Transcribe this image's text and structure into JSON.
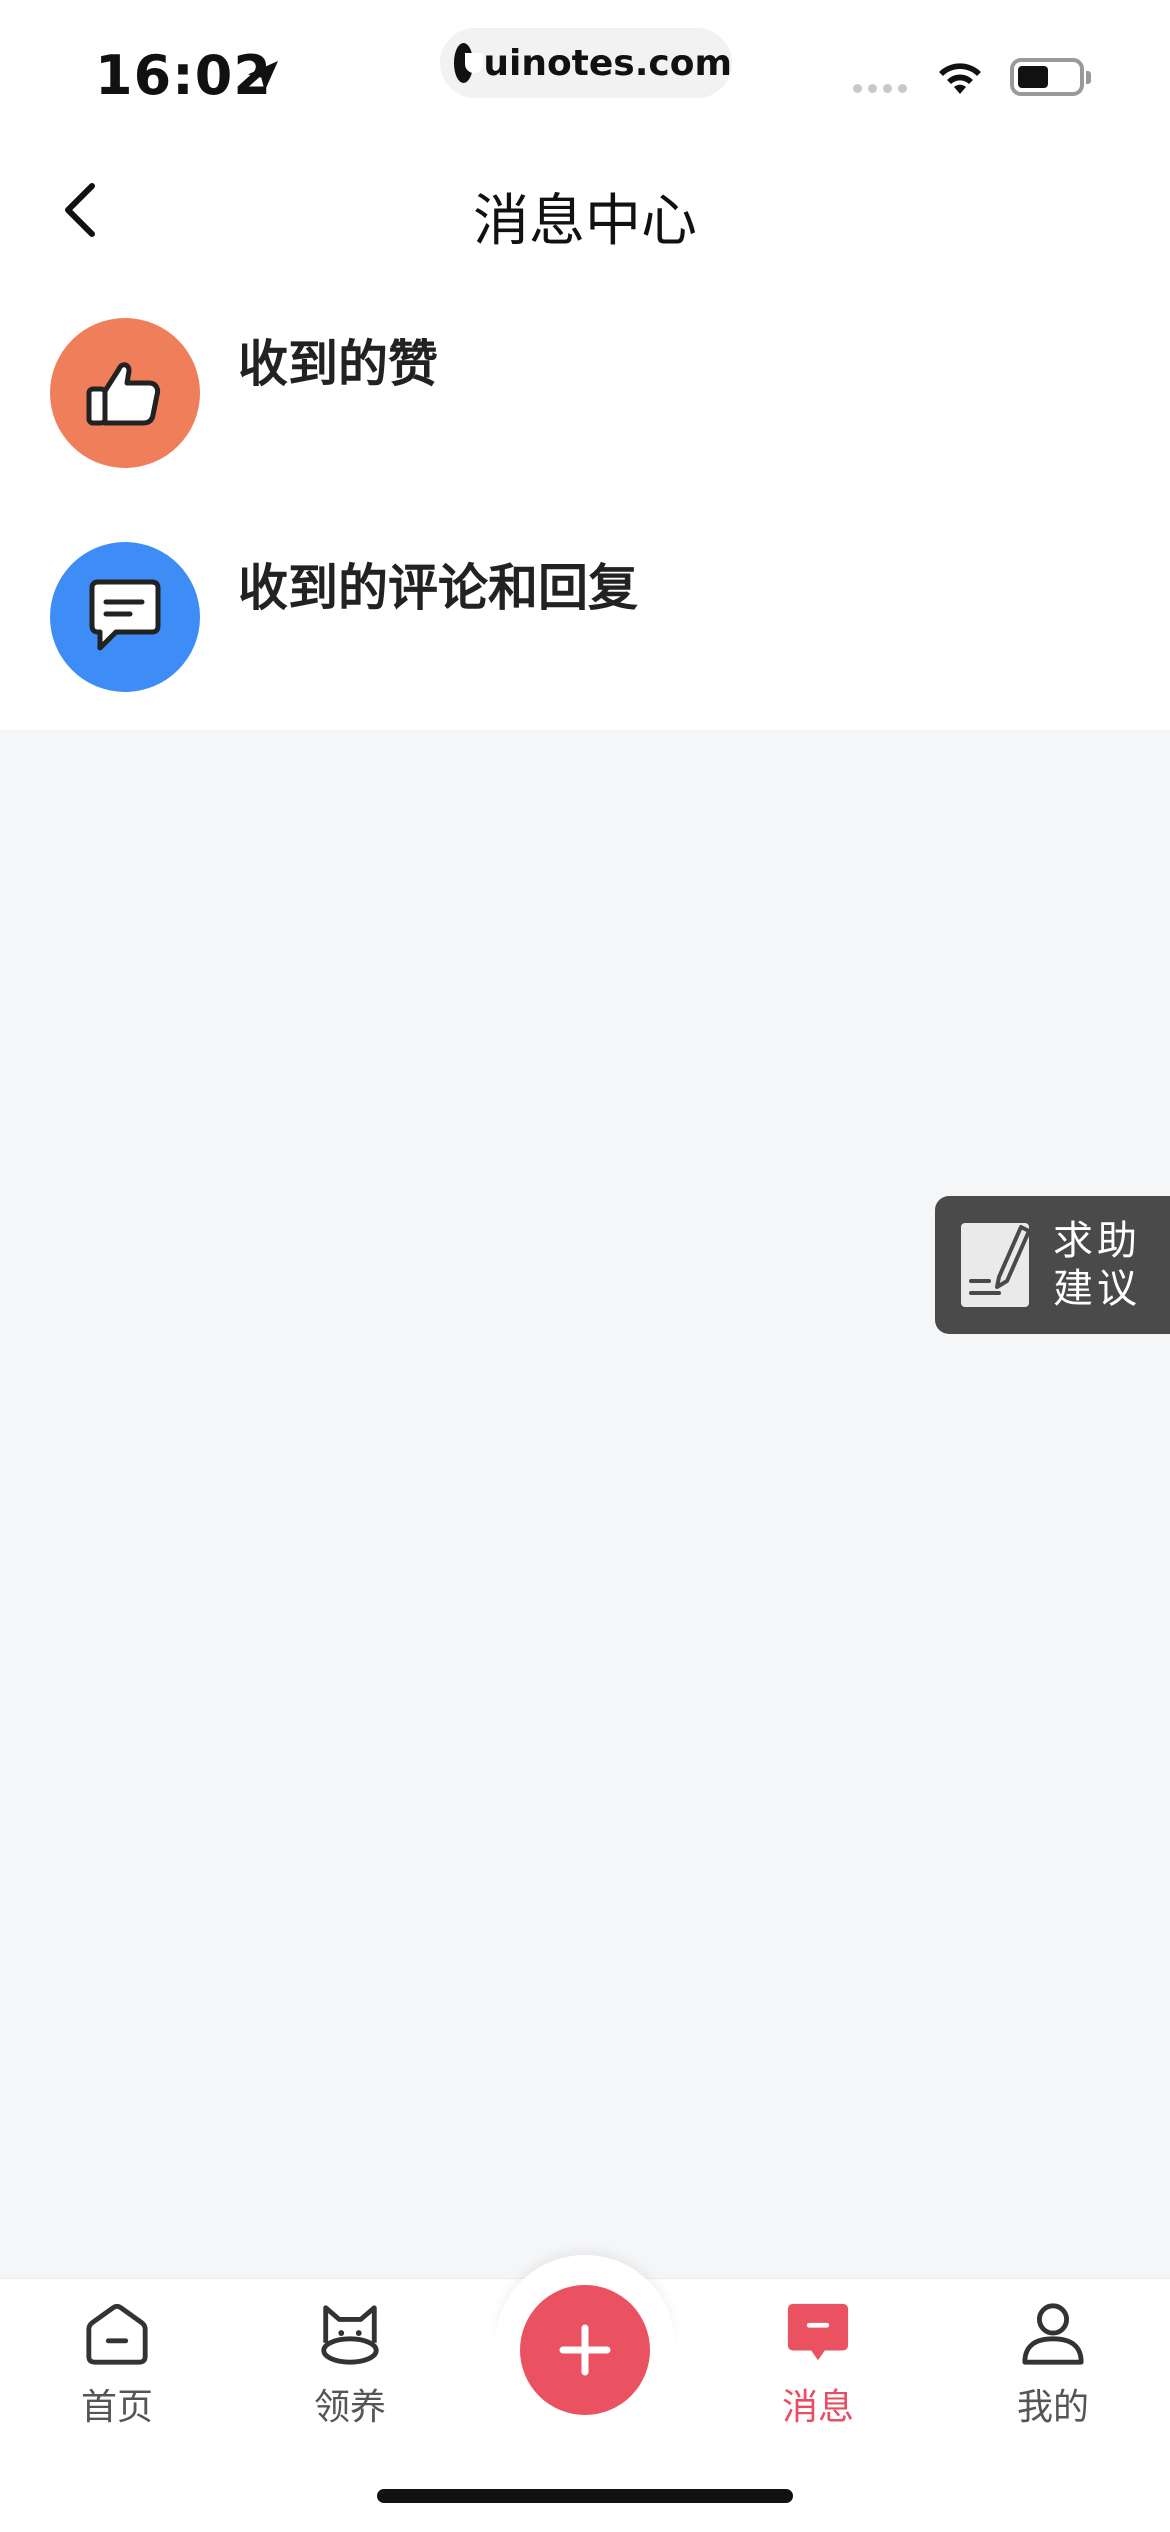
{
  "status_bar": {
    "time": "16:02",
    "url": "uinotes.com"
  },
  "header": {
    "title": "消息中心"
  },
  "messages": [
    {
      "label": "收到的赞",
      "icon": "thumbs-up-icon",
      "color": "#ef7f5a"
    },
    {
      "label": "收到的评论和回复",
      "icon": "comment-icon",
      "color": "#3e8cf6"
    }
  ],
  "help": {
    "line1": "求助",
    "line2": "建议"
  },
  "tabbar": {
    "accent_color": "#ea5261",
    "tabs": [
      {
        "label": "首页",
        "icon": "home-icon",
        "active": false
      },
      {
        "label": "领养",
        "icon": "cat-icon",
        "active": false
      },
      {
        "label": "消息",
        "icon": "message-icon",
        "active": true
      },
      {
        "label": "我的",
        "icon": "profile-icon",
        "active": false
      }
    ]
  }
}
